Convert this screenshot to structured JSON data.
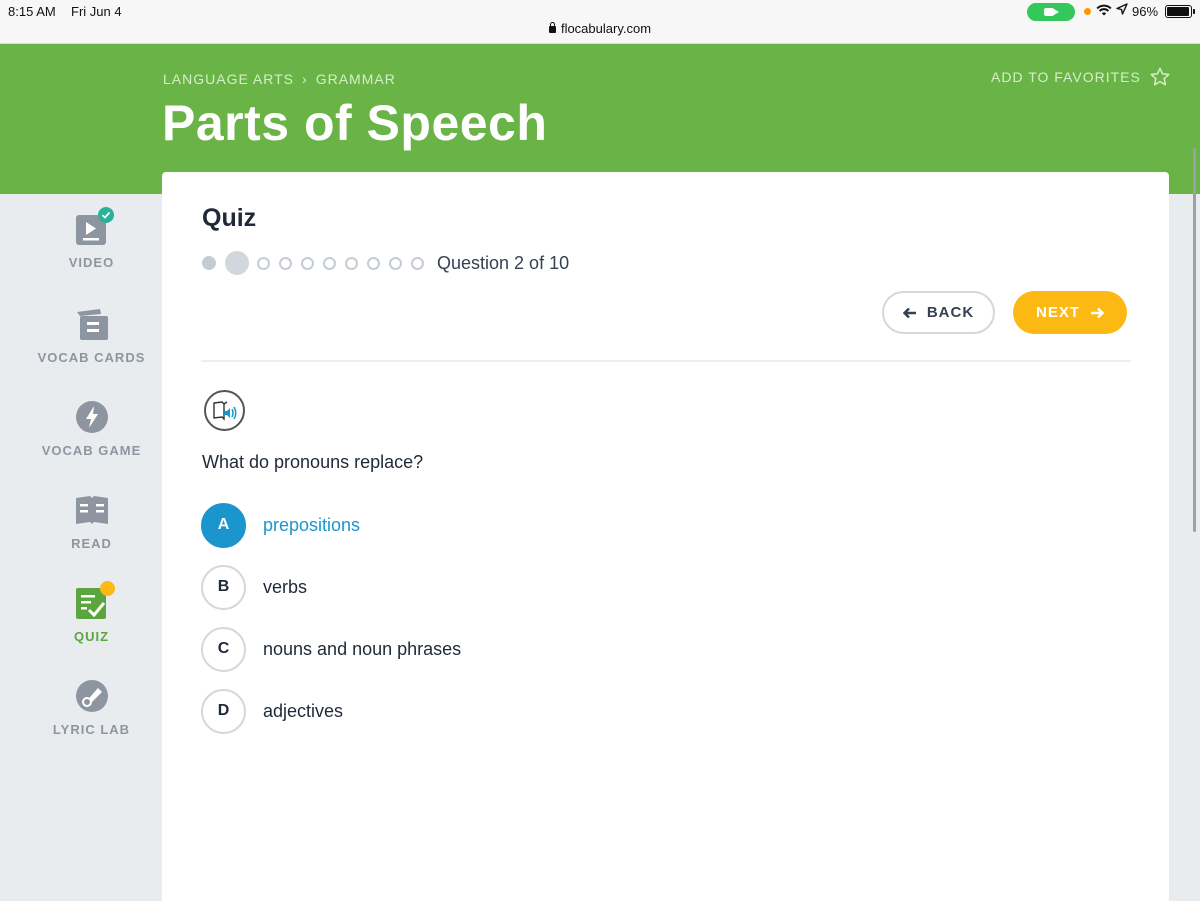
{
  "status_bar": {
    "time": "8:15 AM",
    "date": "Fri Jun 4",
    "url": "flocabulary.com",
    "battery": "96%",
    "battery_level": 0.96
  },
  "header": {
    "breadcrumb": [
      "LANGUAGE ARTS",
      "GRAMMAR"
    ],
    "title": "Parts of Speech",
    "favorites_label": "ADD TO FAVORITES"
  },
  "sidebar": {
    "items": [
      {
        "label": "VIDEO",
        "icon": "video-icon",
        "badge": "completed-check"
      },
      {
        "label": "VOCAB CARDS",
        "icon": "vocab-cards-icon"
      },
      {
        "label": "VOCAB GAME",
        "icon": "lightning-icon"
      },
      {
        "label": "READ",
        "icon": "book-icon"
      },
      {
        "label": "QUIZ",
        "icon": "quiz-icon",
        "active": true,
        "badge": "in-progress-dot"
      },
      {
        "label": "LYRIC LAB",
        "icon": "lyric-lab-icon"
      }
    ]
  },
  "quiz": {
    "title": "Quiz",
    "current_question": 2,
    "total_questions": 10,
    "progress_text": "Question 2 of 10",
    "back_label": "BACK",
    "next_label": "NEXT",
    "question": "What do pronouns replace?",
    "options": [
      {
        "letter": "A",
        "text": "prepositions",
        "selected": true
      },
      {
        "letter": "B",
        "text": "verbs"
      },
      {
        "letter": "C",
        "text": "nouns and noun phrases"
      },
      {
        "letter": "D",
        "text": "adjectives"
      }
    ]
  },
  "colors": {
    "header_green": "#6ab447",
    "accent_blue": "#1b96cc",
    "next_yellow": "#fdb913",
    "active_green": "#5aa63c",
    "badge_orange": "#fdb913",
    "badge_teal": "#2bb19a"
  }
}
